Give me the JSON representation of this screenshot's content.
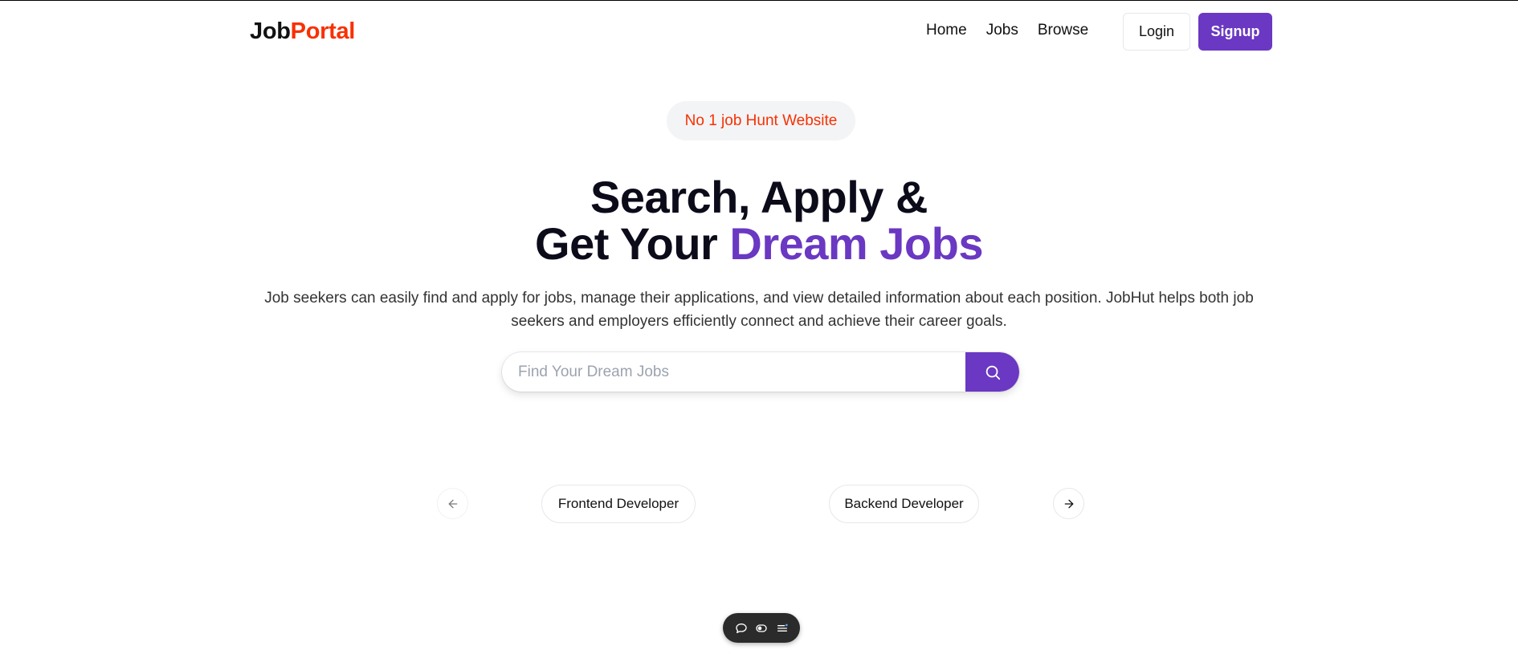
{
  "nav": {
    "logo_part1": "Job",
    "logo_part2": "Portal",
    "links": [
      "Home",
      "Jobs",
      "Browse"
    ],
    "login_label": "Login",
    "signup_label": "Signup"
  },
  "hero": {
    "badge": "No 1 job Hunt Website",
    "title_line1": "Search, Apply &",
    "title_line2_prefix": "Get Your ",
    "title_line2_accent": "Dream Jobs",
    "description": "Job seekers can easily find and apply for jobs, manage their applications, and view detailed information about each position. JobHut helps both job seekers and employers efficiently connect and achieve their career goals."
  },
  "search": {
    "placeholder": "Find Your Dream Jobs",
    "value": ""
  },
  "categories": {
    "items": [
      "Frontend Developer",
      "Backend Developer"
    ]
  },
  "colors": {
    "brand": "#6a38c2",
    "accent_red": "#f83002"
  },
  "icons": {
    "search": "search-icon",
    "prev": "arrow-left-icon",
    "next": "arrow-right-icon",
    "toolbar": [
      "chat-bubble-icon",
      "eye-toggle-icon",
      "menu-list-icon"
    ]
  }
}
